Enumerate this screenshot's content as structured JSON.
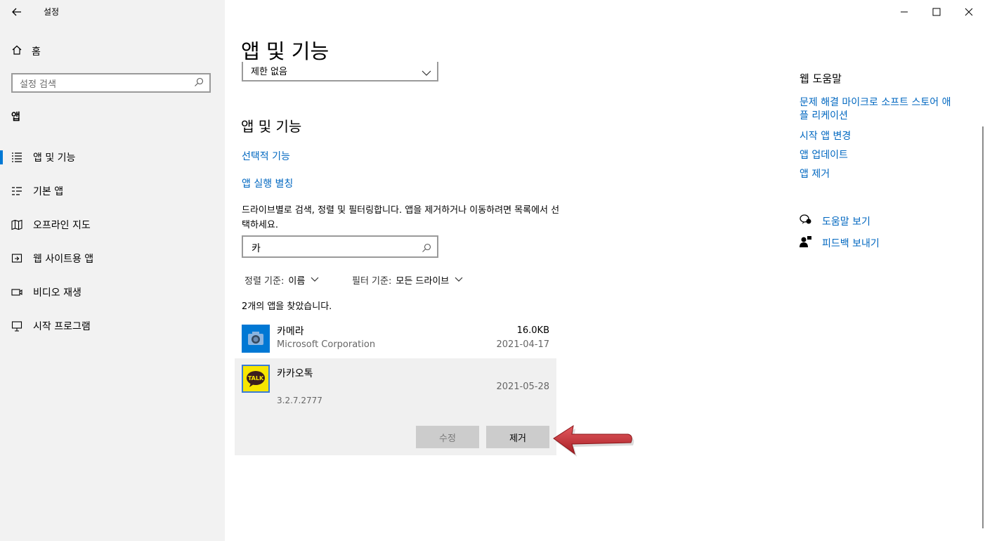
{
  "window": {
    "title": "설정"
  },
  "sidebar": {
    "home_label": "홈",
    "search_placeholder": "설정 검색",
    "section_label": "앱",
    "items": [
      {
        "label": "앱 및 기능",
        "icon": "apps-features-icon",
        "active": true
      },
      {
        "label": "기본 앱",
        "icon": "default-apps-icon"
      },
      {
        "label": "오프라인 지도",
        "icon": "map-icon"
      },
      {
        "label": "웹 사이트용 앱",
        "icon": "web-apps-icon"
      },
      {
        "label": "비디오 재생",
        "icon": "video-icon"
      },
      {
        "label": "시작 프로그램",
        "icon": "startup-icon"
      }
    ]
  },
  "main": {
    "page_title": "앱 및 기능",
    "combo_value": "제한 없음",
    "section_title": "앱 및 기능",
    "link_optional": "선택적 기능",
    "link_alias": "앱 실행 별칭",
    "description": "드라이브별로 검색, 정렬 및 필터링합니다. 앱을 제거하거나 이동하려면 목록에서 선택하세요.",
    "search_value": "카",
    "sort_key": "정렬 기준:",
    "sort_value": "이름",
    "filter_key": "필터 기준:",
    "filter_value": "모든 드라이브",
    "found_text": "2개의 앱을 찾았습니다.",
    "apps": [
      {
        "name": "카메라",
        "publisher": "Microsoft Corporation",
        "size": "16.0KB",
        "date": "2021-04-17"
      },
      {
        "name": "카카오톡",
        "version": "3.2.7.2777",
        "date": "2021-05-28",
        "selected": true,
        "icon_text": "TALK"
      }
    ],
    "buttons": {
      "modify": "수정",
      "uninstall": "제거"
    }
  },
  "right": {
    "title": "웹 도움말",
    "links": [
      "문제 해결 마이크로 소프트 스토어 애플리케이션",
      "시작 앱 변경",
      "앱 업데이트",
      "앱 제거"
    ],
    "link1_line1": "문제 해결 마이크로 소프트 스토어 애",
    "link1_line2": "플 리케이션",
    "get_help": "도움말 보기",
    "feedback": "피드백 보내기"
  },
  "colors": {
    "accent": "#0067c0",
    "sidebar_bg": "#f2f2f2",
    "active_bar": "#0078d4",
    "annotation_arrow": "#c0272d"
  }
}
